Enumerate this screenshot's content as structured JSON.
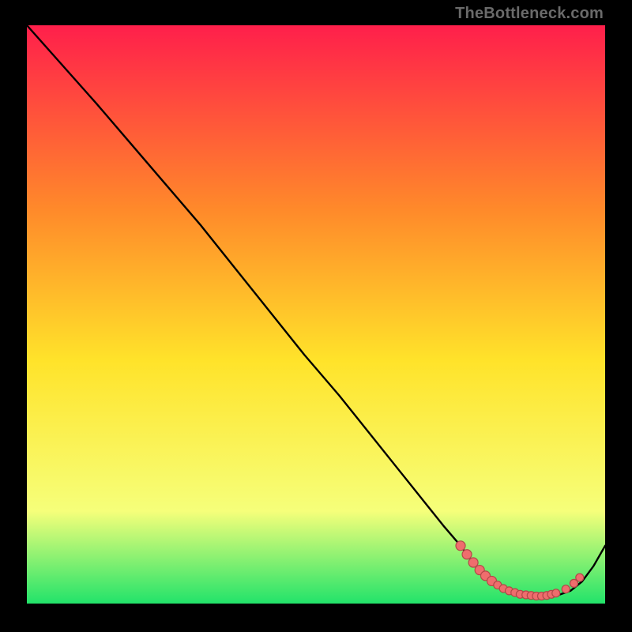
{
  "attribution": "TheBottleneck.com",
  "colors": {
    "gradient_top": "#ff1f4b",
    "gradient_upper_mid": "#ff8a2a",
    "gradient_mid": "#ffe32a",
    "gradient_lower_mid": "#f6ff7a",
    "gradient_bottom": "#22e36a",
    "curve": "#000000",
    "marker_fill": "#ef6d6d",
    "marker_stroke": "#b24848",
    "background": "#000000"
  },
  "chart_data": {
    "type": "line",
    "title": "",
    "xlabel": "",
    "ylabel": "",
    "xlim": [
      0,
      100
    ],
    "ylim": [
      0,
      100
    ],
    "grid": false,
    "legend": false,
    "series": [
      {
        "name": "curve",
        "x": [
          0,
          8,
          12,
          18,
          24,
          30,
          36,
          42,
          48,
          54,
          60,
          66,
          72,
          75,
          78,
          80,
          82,
          84,
          86,
          88,
          90,
          92,
          94,
          96,
          98,
          100
        ],
        "y": [
          100,
          91,
          86.5,
          79.5,
          72.5,
          65.5,
          58,
          50.5,
          43,
          36,
          28.5,
          21,
          13.5,
          10,
          6,
          4.2,
          2.9,
          2.0,
          1.5,
          1.2,
          1.2,
          1.5,
          2.2,
          3.8,
          6.5,
          10
        ]
      }
    ],
    "markers": [
      {
        "x": 75.0,
        "y": 10.0,
        "r": 6
      },
      {
        "x": 76.1,
        "y": 8.5,
        "r": 6
      },
      {
        "x": 77.2,
        "y": 7.1,
        "r": 6
      },
      {
        "x": 78.3,
        "y": 5.8,
        "r": 6
      },
      {
        "x": 79.3,
        "y": 4.8,
        "r": 6
      },
      {
        "x": 80.4,
        "y": 3.9,
        "r": 6
      },
      {
        "x": 81.4,
        "y": 3.2,
        "r": 5
      },
      {
        "x": 82.4,
        "y": 2.6,
        "r": 5
      },
      {
        "x": 83.4,
        "y": 2.2,
        "r": 5
      },
      {
        "x": 84.4,
        "y": 1.9,
        "r": 5
      },
      {
        "x": 85.3,
        "y": 1.6,
        "r": 5
      },
      {
        "x": 86.3,
        "y": 1.5,
        "r": 5
      },
      {
        "x": 87.2,
        "y": 1.4,
        "r": 5
      },
      {
        "x": 88.1,
        "y": 1.3,
        "r": 5
      },
      {
        "x": 89.0,
        "y": 1.3,
        "r": 5
      },
      {
        "x": 89.9,
        "y": 1.4,
        "r": 5
      },
      {
        "x": 90.7,
        "y": 1.6,
        "r": 5
      },
      {
        "x": 91.5,
        "y": 1.8,
        "r": 5
      },
      {
        "x": 93.2,
        "y": 2.5,
        "r": 5
      },
      {
        "x": 94.6,
        "y": 3.5,
        "r": 5
      },
      {
        "x": 95.6,
        "y": 4.5,
        "r": 5
      }
    ],
    "annotations": []
  }
}
